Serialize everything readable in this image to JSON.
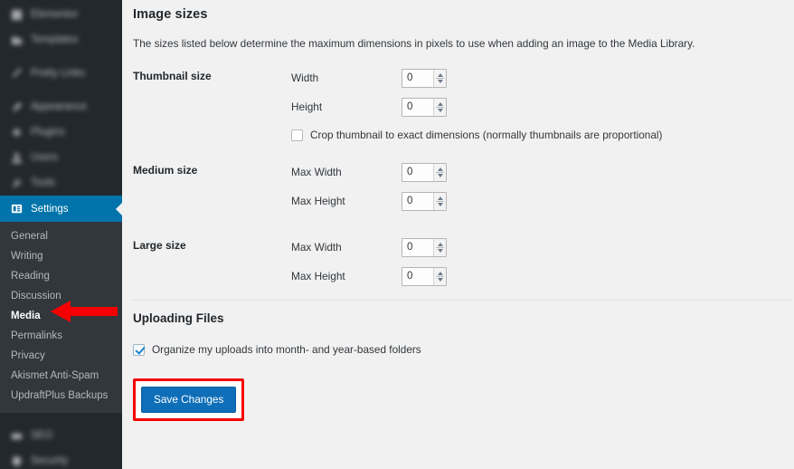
{
  "sidebar": {
    "top_items": [
      {
        "label": "Elementor",
        "icon": "elementor-icon",
        "blurred": true
      },
      {
        "label": "Templates",
        "icon": "templates-icon",
        "blurred": true
      },
      {
        "label": "Pretty Links",
        "icon": "pretty-links-icon",
        "blurred": true
      },
      {
        "label": "Appearance",
        "icon": "appearance-brush-icon",
        "blurred": true
      },
      {
        "label": "Plugins",
        "icon": "plugins-icon",
        "blurred": true
      },
      {
        "label": "Users",
        "icon": "users-icon",
        "blurred": true
      },
      {
        "label": "Tools",
        "icon": "tools-wrench-icon",
        "blurred": true
      }
    ],
    "active_item": {
      "label": "Settings",
      "icon": "settings-sliders-icon"
    },
    "submenu": [
      {
        "label": "General",
        "current": false
      },
      {
        "label": "Writing",
        "current": false
      },
      {
        "label": "Reading",
        "current": false
      },
      {
        "label": "Discussion",
        "current": false
      },
      {
        "label": "Media",
        "current": true
      },
      {
        "label": "Permalinks",
        "current": false
      },
      {
        "label": "Privacy",
        "current": false
      },
      {
        "label": "Akismet Anti-Spam",
        "current": false
      },
      {
        "label": "UpdraftPlus Backups",
        "current": false
      }
    ],
    "bottom_items": [
      {
        "label": "SEO",
        "icon": "seo-icon",
        "blurred": true
      },
      {
        "label": "Security",
        "icon": "security-shield-icon",
        "blurred": true
      }
    ]
  },
  "main": {
    "image_sizes_title": "Image sizes",
    "image_sizes_description": "The sizes listed below determine the maximum dimensions in pixels to use when adding an image to the Media Library.",
    "sections": [
      {
        "label": "Thumbnail size",
        "fields": [
          {
            "label": "Width",
            "value": "0"
          },
          {
            "label": "Height",
            "value": "0"
          }
        ],
        "checkbox": {
          "label": "Crop thumbnail to exact dimensions (normally thumbnails are proportional)",
          "checked": false
        }
      },
      {
        "label": "Medium size",
        "fields": [
          {
            "label": "Max Width",
            "value": "0"
          },
          {
            "label": "Max Height",
            "value": "0"
          }
        ]
      },
      {
        "label": "Large size",
        "fields": [
          {
            "label": "Max Width",
            "value": "0"
          },
          {
            "label": "Max Height",
            "value": "0"
          }
        ]
      }
    ],
    "uploading_files_title": "Uploading Files",
    "organize_uploads": {
      "label": "Organize my uploads into month- and year-based folders",
      "checked": true
    },
    "save_button_label": "Save Changes"
  },
  "annotations": {
    "arrow_color": "#f40000",
    "arrow_target": "Media",
    "highlight_box_color": "#f40000",
    "highlight_box_target": "Save Changes"
  },
  "colors": {
    "sidebar_bg": "#23282d",
    "submenu_bg": "#32373c",
    "active_menu_bg": "#0073aa",
    "content_bg": "#f1f1f1",
    "primary_button_bg": "#0e6eb8",
    "annotation_red": "#f40000"
  }
}
